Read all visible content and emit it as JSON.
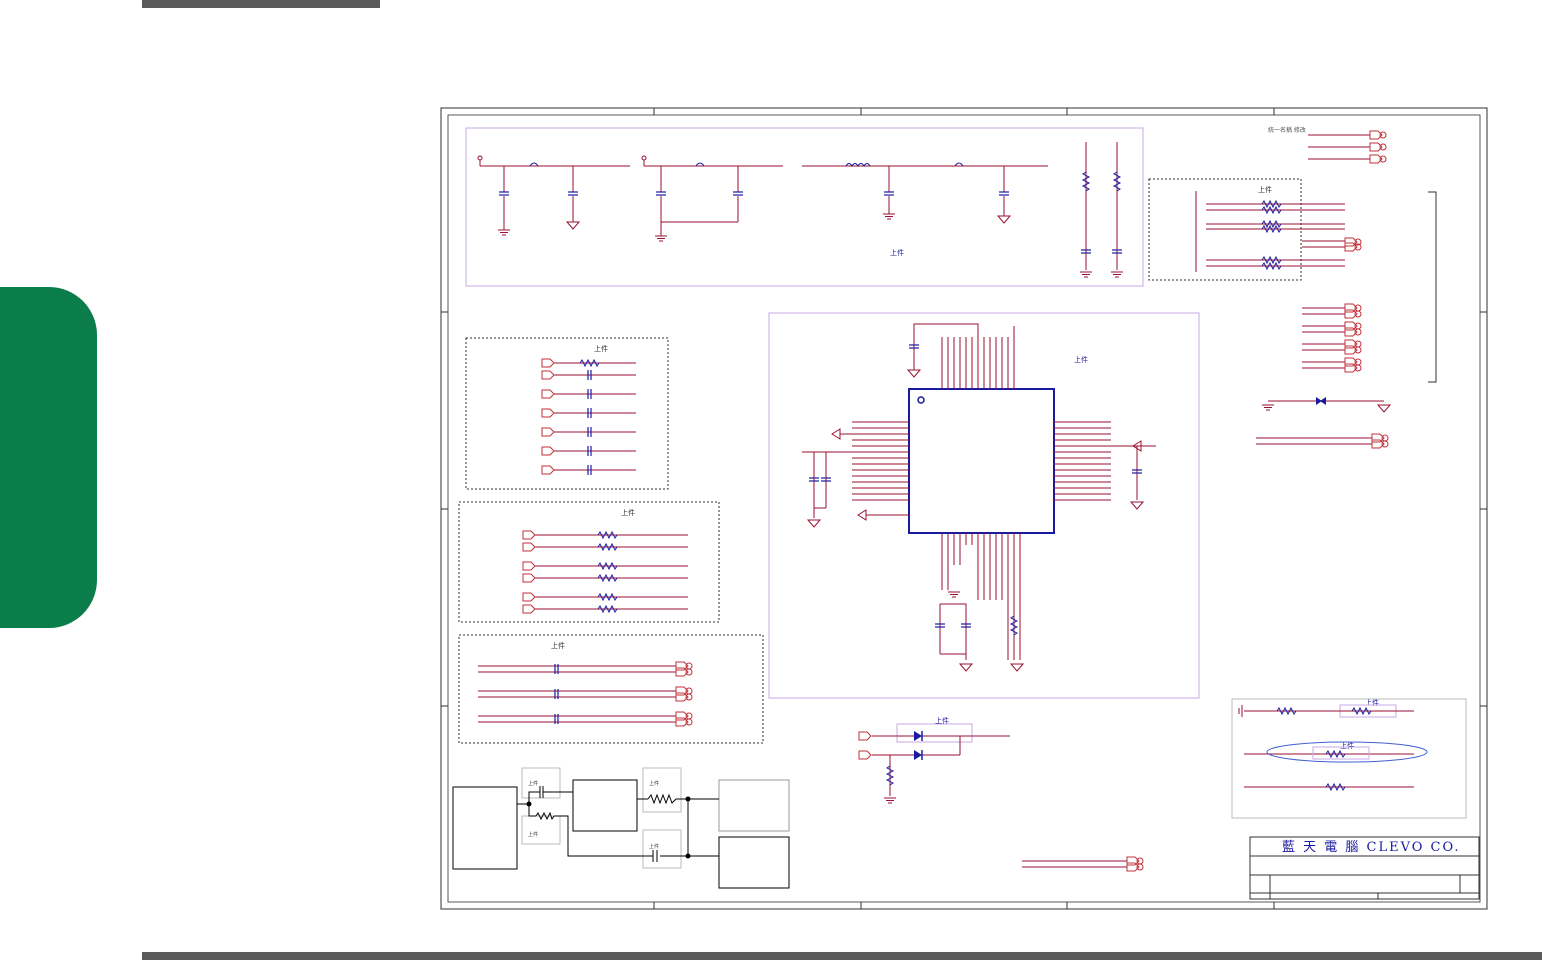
{
  "page": {
    "accent_tab_color": "#0a7d4a",
    "bar_color": "#5a5a5a"
  },
  "schematic": {
    "part_label": "上件",
    "note_text": "統一名稱 修改",
    "title_block": {
      "company": "藍 天 電 腦   CLEVO CO."
    }
  },
  "colors": {
    "wire": "#9a1030",
    "component": "#1a1aa0",
    "box_border": "#c9a8e8",
    "frame": "#303030"
  }
}
